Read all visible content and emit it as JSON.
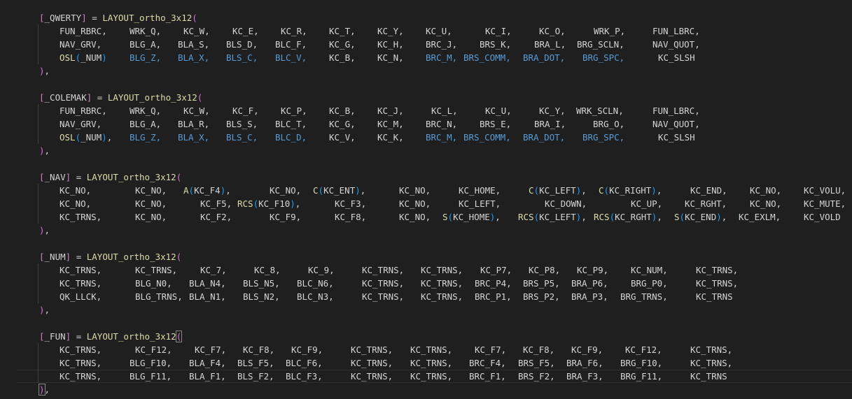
{
  "editor": {
    "blocks": [
      {
        "header": "[_QWERTY] = LAYOUT_ortho_3x12(",
        "rows": [
          [
            [
              "FUN_RBRC,",
              "t"
            ],
            [
              "WRK_Q,",
              "t"
            ],
            [
              "KC_W,",
              "t"
            ],
            [
              "KC_E,",
              "t"
            ],
            [
              "KC_R,",
              "t"
            ],
            [
              "KC_T,",
              "t"
            ],
            [
              "KC_Y,",
              "t"
            ],
            [
              "KC_U,",
              "t"
            ],
            [
              "KC_I,",
              "t"
            ],
            [
              "KC_O,",
              "t"
            ],
            [
              "WRK_P,",
              "t"
            ],
            [
              "FUN_LBRC,",
              "t"
            ]
          ],
          [
            [
              "NAV_GRV,",
              "t"
            ],
            [
              "BLG_A,",
              "t"
            ],
            [
              "BLA_S,",
              "t"
            ],
            [
              "BLS_D,",
              "t"
            ],
            [
              "BLC_F,",
              "t"
            ],
            [
              "KC_G,",
              "t"
            ],
            [
              "KC_H,",
              "t"
            ],
            [
              "BRC_J,",
              "t"
            ],
            [
              "BRS_K,",
              "t"
            ],
            [
              "BRA_L,",
              "t"
            ],
            [
              "BRG_SCLN,",
              "t"
            ],
            [
              "NAV_QUOT,",
              "t"
            ]
          ],
          [
            [
              "OSL(_NUM)",
              "f"
            ],
            [
              "BLG_Z,",
              "b"
            ],
            [
              "BLA_X,",
              "b"
            ],
            [
              "BLS_C,",
              "b"
            ],
            [
              "BLC_V,",
              "b"
            ],
            [
              "KC_B,",
              "t"
            ],
            [
              "KC_N,",
              "t"
            ],
            [
              "BRC_M,",
              "b"
            ],
            [
              "BRS_COMM,",
              "b"
            ],
            [
              "BRA_DOT,",
              "b"
            ],
            [
              "BRG_SPC,",
              "b"
            ],
            [
              "KC_SLSH",
              "t"
            ]
          ]
        ],
        "footer": "),"
      },
      {
        "header": "[_COLEMAK] = LAYOUT_ortho_3x12(",
        "rows": [
          [
            [
              "FUN_RBRC,",
              "t"
            ],
            [
              "WRK_Q,",
              "t"
            ],
            [
              "KC_W,",
              "t"
            ],
            [
              "KC_F,",
              "t"
            ],
            [
              "KC_P,",
              "t"
            ],
            [
              "KC_B,",
              "t"
            ],
            [
              "KC_J,",
              "t"
            ],
            [
              "KC_L,",
              "t"
            ],
            [
              "KC_U,",
              "t"
            ],
            [
              "KC_Y,",
              "t"
            ],
            [
              "WRK_SCLN,",
              "t"
            ],
            [
              "FUN_LBRC,",
              "t"
            ]
          ],
          [
            [
              "NAV_GRV,",
              "t"
            ],
            [
              "BLG_A,",
              "t"
            ],
            [
              "BLA_R,",
              "t"
            ],
            [
              "BLS_S,",
              "t"
            ],
            [
              "BLC_T,",
              "t"
            ],
            [
              "KC_G,",
              "t"
            ],
            [
              "KC_M,",
              "t"
            ],
            [
              "BRC_N,",
              "t"
            ],
            [
              "BRS_E,",
              "t"
            ],
            [
              "BRA_I,",
              "t"
            ],
            [
              "BRG_O,",
              "t"
            ],
            [
              "NAV_QUOT,",
              "t"
            ]
          ],
          [
            [
              "OSL(_NUM),",
              "f"
            ],
            [
              "BLG_Z,",
              "b"
            ],
            [
              "BLA_X,",
              "b"
            ],
            [
              "BLS_C,",
              "b"
            ],
            [
              "BLC_D,",
              "b"
            ],
            [
              "KC_V,",
              "t"
            ],
            [
              "KC_K,",
              "t"
            ],
            [
              "BRC_M,",
              "b"
            ],
            [
              "BRS_COMM,",
              "b"
            ],
            [
              "BRA_DOT,",
              "b"
            ],
            [
              "BRG_SPC,",
              "b"
            ],
            [
              "KC_SLSH",
              "t"
            ]
          ]
        ],
        "footer": "),"
      },
      {
        "header": "[_NAV] = LAYOUT_ortho_3x12(",
        "rows": [
          [
            [
              "KC_NO,",
              "t"
            ],
            [
              "KC_NO,",
              "t"
            ],
            [
              "A(KC_F4),",
              "f"
            ],
            [
              "KC_NO,",
              "t"
            ],
            [
              "C(KC_ENT),",
              "f"
            ],
            [
              "KC_NO,",
              "t"
            ],
            [
              "KC_HOME,",
              "t"
            ],
            [
              "C(KC_LEFT),",
              "f"
            ],
            [
              "C(KC_RIGHT),",
              "f"
            ],
            [
              "KC_END,",
              "t"
            ],
            [
              "KC_NO,",
              "t"
            ],
            [
              "KC_VOLU,",
              "t"
            ]
          ],
          [
            [
              "KC_NO,",
              "t"
            ],
            [
              "KC_NO,",
              "t"
            ],
            [
              "KC_F5,",
              "t"
            ],
            [
              "RCS(KC_F10),",
              "f"
            ],
            [
              "KC_F3,",
              "t"
            ],
            [
              "KC_NO,",
              "t"
            ],
            [
              "KC_LEFT,",
              "t"
            ],
            [
              "KC_DOWN,",
              "t"
            ],
            [
              "KC_UP,",
              "t"
            ],
            [
              "KC_RGHT,",
              "t"
            ],
            [
              "KC_NO,",
              "t"
            ],
            [
              "KC_MUTE,",
              "t"
            ]
          ],
          [
            [
              "KC_TRNS,",
              "t"
            ],
            [
              "KC_NO,",
              "t"
            ],
            [
              "KC_F2,",
              "t"
            ],
            [
              "KC_F9,",
              "t"
            ],
            [
              "KC_F8,",
              "t"
            ],
            [
              "KC_NO,",
              "t"
            ],
            [
              "S(KC_HOME),",
              "f"
            ],
            [
              "RCS(KC_LEFT),",
              "f"
            ],
            [
              "RCS(KC_RGHT),",
              "f"
            ],
            [
              "S(KC_END),",
              "f"
            ],
            [
              "KC_EXLM,",
              "t"
            ],
            [
              "KC_VOLD",
              "t"
            ]
          ]
        ],
        "footer": "),"
      },
      {
        "header": "[_NUM] = LAYOUT_ortho_3x12(",
        "rows": [
          [
            [
              "KC_TRNS,",
              "t"
            ],
            [
              "KC_TRNS,",
              "t"
            ],
            [
              "KC_7,",
              "t"
            ],
            [
              "KC_8,",
              "t"
            ],
            [
              "KC_9,",
              "t"
            ],
            [
              "KC_TRNS,",
              "t"
            ],
            [
              "KC_TRNS,",
              "t"
            ],
            [
              "KC_P7,",
              "t"
            ],
            [
              "KC_P8,",
              "t"
            ],
            [
              "KC_P9,",
              "t"
            ],
            [
              "KC_NUM,",
              "t"
            ],
            [
              "KC_TRNS,",
              "t"
            ]
          ],
          [
            [
              "KC_TRNS,",
              "t"
            ],
            [
              "BLG_N0,",
              "t"
            ],
            [
              "BLA_N4,",
              "t"
            ],
            [
              "BLS_N5,",
              "t"
            ],
            [
              "BLC_N6,",
              "t"
            ],
            [
              "KC_TRNS,",
              "t"
            ],
            [
              "KC_TRNS,",
              "t"
            ],
            [
              "BRC_P4,",
              "t"
            ],
            [
              "BRS_P5,",
              "t"
            ],
            [
              "BRA_P6,",
              "t"
            ],
            [
              "BRG_P0,",
              "t"
            ],
            [
              "KC_TRNS,",
              "t"
            ]
          ],
          [
            [
              "QK_LLCK,",
              "t"
            ],
            [
              "BLG_TRNS,",
              "t"
            ],
            [
              "BLA_N1,",
              "t"
            ],
            [
              "BLS_N2,",
              "t"
            ],
            [
              "BLC_N3,",
              "t"
            ],
            [
              "KC_TRNS,",
              "t"
            ],
            [
              "KC_TRNS,",
              "t"
            ],
            [
              "BRC_P1,",
              "t"
            ],
            [
              "BRS_P2,",
              "t"
            ],
            [
              "BRA_P3,",
              "t"
            ],
            [
              "BRG_TRNS,",
              "t"
            ],
            [
              "KC_TRNS",
              "t"
            ]
          ]
        ],
        "footer": "),"
      },
      {
        "header": "[_FUN] = LAYOUT_ortho_3x12(",
        "rows": [
          [
            [
              "KC_TRNS,",
              "t"
            ],
            [
              "KC_F12,",
              "t"
            ],
            [
              "KC_F7,",
              "t"
            ],
            [
              "KC_F8,",
              "t"
            ],
            [
              "KC_F9,",
              "t"
            ],
            [
              "KC_TRNS,",
              "t"
            ],
            [
              "KC_TRNS,",
              "t"
            ],
            [
              "KC_F7,",
              "t"
            ],
            [
              "KC_F8,",
              "t"
            ],
            [
              "KC_F9,",
              "t"
            ],
            [
              "KC_F12,",
              "t"
            ],
            [
              "KC_TRNS,",
              "t"
            ]
          ],
          [
            [
              "KC_TRNS,",
              "t"
            ],
            [
              "BLG_F10,",
              "t"
            ],
            [
              "BLA_F4,",
              "t"
            ],
            [
              "BLS_F5,",
              "t"
            ],
            [
              "BLC_F6,",
              "t"
            ],
            [
              "KC_TRNS,",
              "t"
            ],
            [
              "KC_TRNS,",
              "t"
            ],
            [
              "BRC_F4,",
              "t"
            ],
            [
              "BRS_F5,",
              "t"
            ],
            [
              "BRA_F6,",
              "t"
            ],
            [
              "BRG_F10,",
              "t"
            ],
            [
              "KC_TRNS,",
              "t"
            ]
          ],
          [
            [
              "KC_TRNS,",
              "t"
            ],
            [
              "BLG_F11,",
              "t"
            ],
            [
              "BLA_F1,",
              "t"
            ],
            [
              "BLS_F2,",
              "t"
            ],
            [
              "BLC_F3,",
              "t"
            ],
            [
              "KC_TRNS,",
              "t"
            ],
            [
              "KC_TRNS,",
              "t"
            ],
            [
              "BRC_F1,",
              "t"
            ],
            [
              "BRS_F2,",
              "t"
            ],
            [
              "BRA_F3,",
              "t"
            ],
            [
              "BRG_F11,",
              "t"
            ],
            [
              "KC_TRNS",
              "t"
            ]
          ]
        ],
        "footer": "),"
      }
    ]
  }
}
